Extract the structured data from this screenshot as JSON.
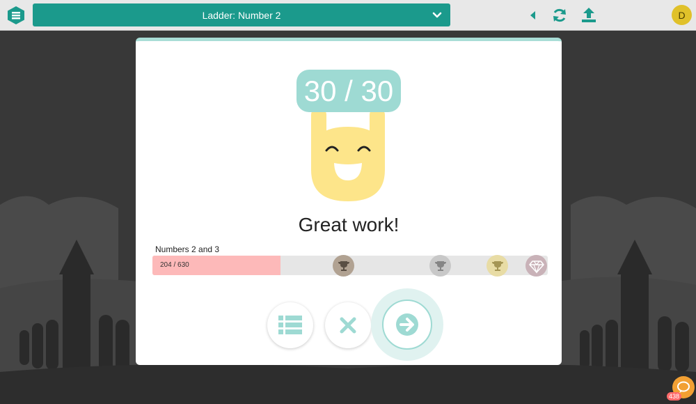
{
  "header": {
    "title": "Ladder: Number 2",
    "avatar_initial": "D"
  },
  "result": {
    "score": "30 / 30",
    "message": "Great work!"
  },
  "progress": {
    "label": "Numbers 2 and 3",
    "text": "204 / 630",
    "current": 204,
    "max": 630,
    "milestones": [
      "bronze-trophy",
      "silver-trophy",
      "gold-trophy",
      "diamond"
    ]
  },
  "actions": [
    "list-button",
    "close-button",
    "next-button"
  ],
  "chat": {
    "count": "438"
  },
  "colors": {
    "accent": "#1b9a8c",
    "score_pill": "#9edad3",
    "progress_fill": "#fdb9b9",
    "mascot": "#fde58a"
  }
}
